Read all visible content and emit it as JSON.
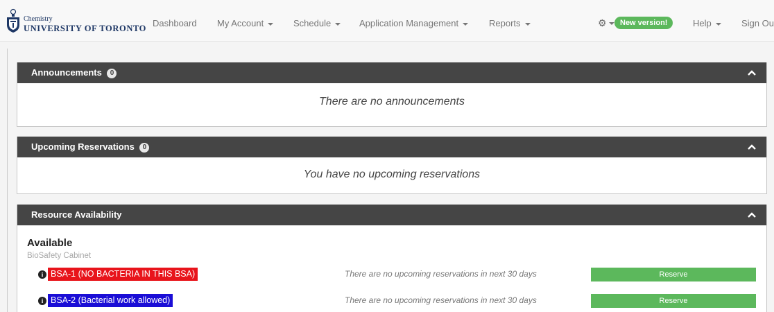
{
  "brand": {
    "department": "Chemistry",
    "university": "UNIVERSITY OF TORONTO",
    "crest_color": "#1e3765"
  },
  "nav": {
    "items": [
      {
        "label": "Dashboard",
        "dropdown": false
      },
      {
        "label": "My Account",
        "dropdown": true
      },
      {
        "label": "Schedule",
        "dropdown": true
      },
      {
        "label": "Application Management",
        "dropdown": true
      },
      {
        "label": "Reports",
        "dropdown": true
      }
    ],
    "settings_icon": "gear-icon",
    "new_version_badge": "New version!",
    "help_label": "Help",
    "sign_out_label": "Sign Out"
  },
  "panels": {
    "announcements": {
      "title": "Announcements",
      "count": "0",
      "empty_message": "There are no announcements"
    },
    "upcoming": {
      "title": "Upcoming Reservations",
      "count": "0",
      "empty_message": "You have no upcoming reservations"
    },
    "availability": {
      "title": "Resource Availability",
      "section_title": "Available",
      "section_subtitle": "BioSafety Cabinet",
      "resources": [
        {
          "label": "BSA-1 (NO BACTERIA IN THIS BSA)",
          "color": "#e8141b",
          "note": "There are no upcoming reservations in next 30 days",
          "button": "Reserve"
        },
        {
          "label": "BSA-2 (Bacterial work allowed)",
          "color": "#1a0dd6",
          "note": "There are no upcoming reservations in next 30 days",
          "button": "Reserve"
        }
      ]
    }
  },
  "colors": {
    "panel_header": "#454545",
    "success": "#5cb85c"
  }
}
